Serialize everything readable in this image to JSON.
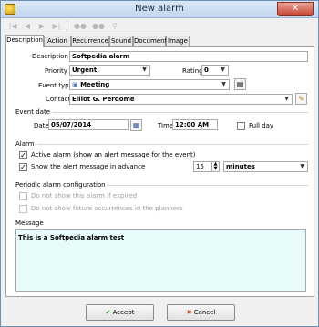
{
  "window": {
    "title": "New alarm"
  },
  "toolbar": {
    "buttons": [
      "first-icon",
      "prev-icon",
      "next-icon",
      "last-icon",
      "group-icon",
      "group-add-icon",
      "search-icon"
    ]
  },
  "tabs": [
    {
      "label": "Description",
      "active": true
    },
    {
      "label": "Action"
    },
    {
      "label": "Recurrence"
    },
    {
      "label": "Sound"
    },
    {
      "label": "Document"
    },
    {
      "label": "Image"
    }
  ],
  "description": {
    "label": "Description",
    "value": "Softpedia alarm"
  },
  "priority": {
    "label": "Priority",
    "value": "Urgent"
  },
  "rating": {
    "label": "Rating",
    "value": "0"
  },
  "event_type": {
    "label": "Event type",
    "value": "Meeting"
  },
  "contact": {
    "label": "Contact",
    "value": "Elliot G. Perdome"
  },
  "event_date": {
    "group_title": "Event date",
    "date_label": "Date",
    "date_value": "05/07/2014",
    "time_label": "Time",
    "time_value": "12:00 AM",
    "full_day_label": "Full day"
  },
  "alarm": {
    "group_title": "Alarm",
    "active_label": "Active alarm (show an alert message for the event)",
    "advance_label": "Show the alert message in advance",
    "advance_value": "15",
    "advance_unit": "minutes"
  },
  "periodic": {
    "group_title": "Periodic alarm configuration",
    "expired_label": "Do not show this alarm if expired",
    "future_label": "Do not show future occurrences in the planners"
  },
  "message": {
    "label": "Message",
    "text": "This is a Softpedia alarm test"
  },
  "buttons": {
    "accept": "Accept",
    "cancel": "Cancel"
  },
  "colors": {
    "accept_check": "#2a9d2a",
    "cancel_x": "#c8432f",
    "memo_bg": "#e8fbfb"
  }
}
